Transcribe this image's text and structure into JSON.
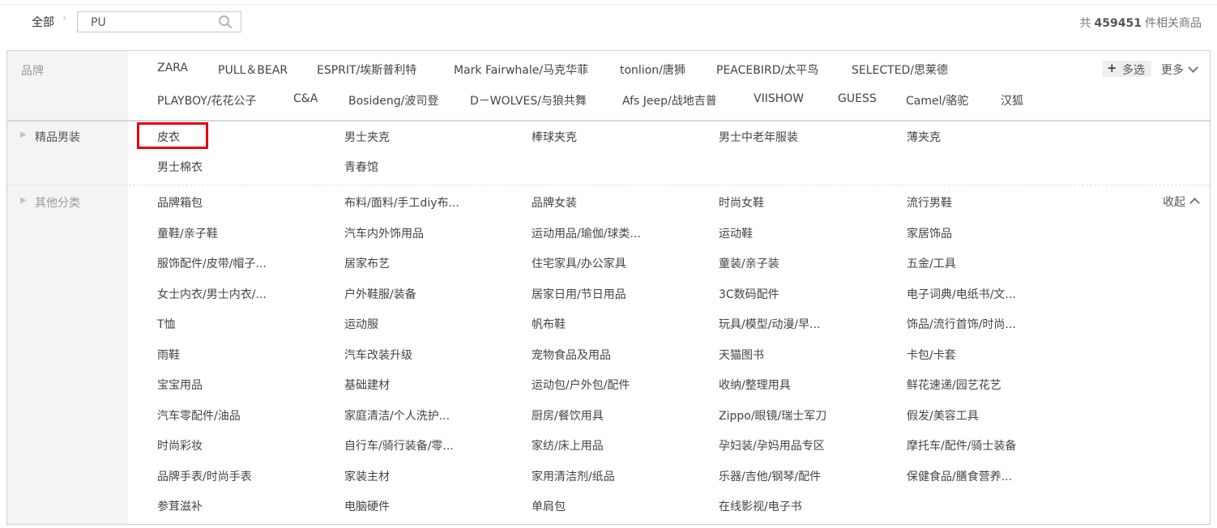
{
  "breadcrumb": {
    "all_label": "全部",
    "arrow": "›"
  },
  "search": {
    "value": "PU"
  },
  "icons": {
    "search": "search-icon",
    "multi": "plus-icon",
    "more": "chevron-down-icon",
    "collapse": "chevron-up-icon"
  },
  "total": {
    "prefix": "共",
    "count": "459451",
    "suffix": "件相关商品"
  },
  "brand": {
    "label": "品牌",
    "items": [
      "ZARA",
      "PULL＆BEAR",
      "ESPRIT/埃斯普利特",
      "Mark Fairwhale/马克华菲",
      "tonlion/唐狮",
      "PEACEBIRD/太平鸟",
      "SELECTED/思莱德",
      "PLAYBOY/花花公子",
      "C&A",
      "Bosideng/波司登",
      "D－WOLVES/与狼共舞",
      "Afs Jeep/战地吉普",
      "VIISHOW",
      "GUESS",
      "Camel/骆驼",
      "汉狐"
    ],
    "multi_label": "多选",
    "more_label": "更多"
  },
  "mens": {
    "label": "精品男装",
    "items": [
      "皮衣",
      "男士夹克",
      "棒球夹克",
      "男士中老年服装",
      "薄夹克",
      "男士棉衣",
      "青春馆"
    ]
  },
  "other": {
    "label": "其他分类",
    "collapse_label": "收起",
    "items": [
      "品牌箱包",
      "布料/面料/手工diy布...",
      "品牌女装",
      "时尚女鞋",
      "流行男鞋",
      "童鞋/亲子鞋",
      "汽车内外饰用品",
      "运动用品/瑜伽/球类...",
      "运动鞋",
      "家居饰品",
      "服饰配件/皮带/帽子...",
      "居家布艺",
      "住宅家具/办公家具",
      "童装/亲子装",
      "五金/工具",
      "女士内衣/男士内衣/...",
      "户外鞋服/装备",
      "居家日用/节日用品",
      "3C数码配件",
      "电子词典/电纸书/文...",
      "T恤",
      "运动服",
      "帆布鞋",
      "玩具/模型/动漫/早...",
      "饰品/流行首饰/时尚...",
      "雨鞋",
      "汽车改装升级",
      "宠物食品及用品",
      "天猫图书",
      "卡包/卡套",
      "宝宝用品",
      "基础建材",
      "运动包/户外包/配件",
      "收纳/整理用具",
      "鲜花速递/园艺花艺",
      "汽车零配件/油品",
      "家庭清洁/个人洗护...",
      "厨房/餐饮用具",
      "Zippo/眼镜/瑞士军刀",
      "假发/美容工具",
      "时尚彩妆",
      "自行车/骑行装备/零...",
      "家纺/床上用品",
      "孕妇装/孕妈用品专区",
      "摩托车/配件/骑士装备",
      "品牌手表/时尚手表",
      "家装主材",
      "家用清洁剂/纸品",
      "乐器/吉他/钢琴/配件",
      "保健食品/膳食营养...",
      "参茸滋补",
      "电脑硬件",
      "单肩包",
      "在线影视/电子书"
    ]
  }
}
